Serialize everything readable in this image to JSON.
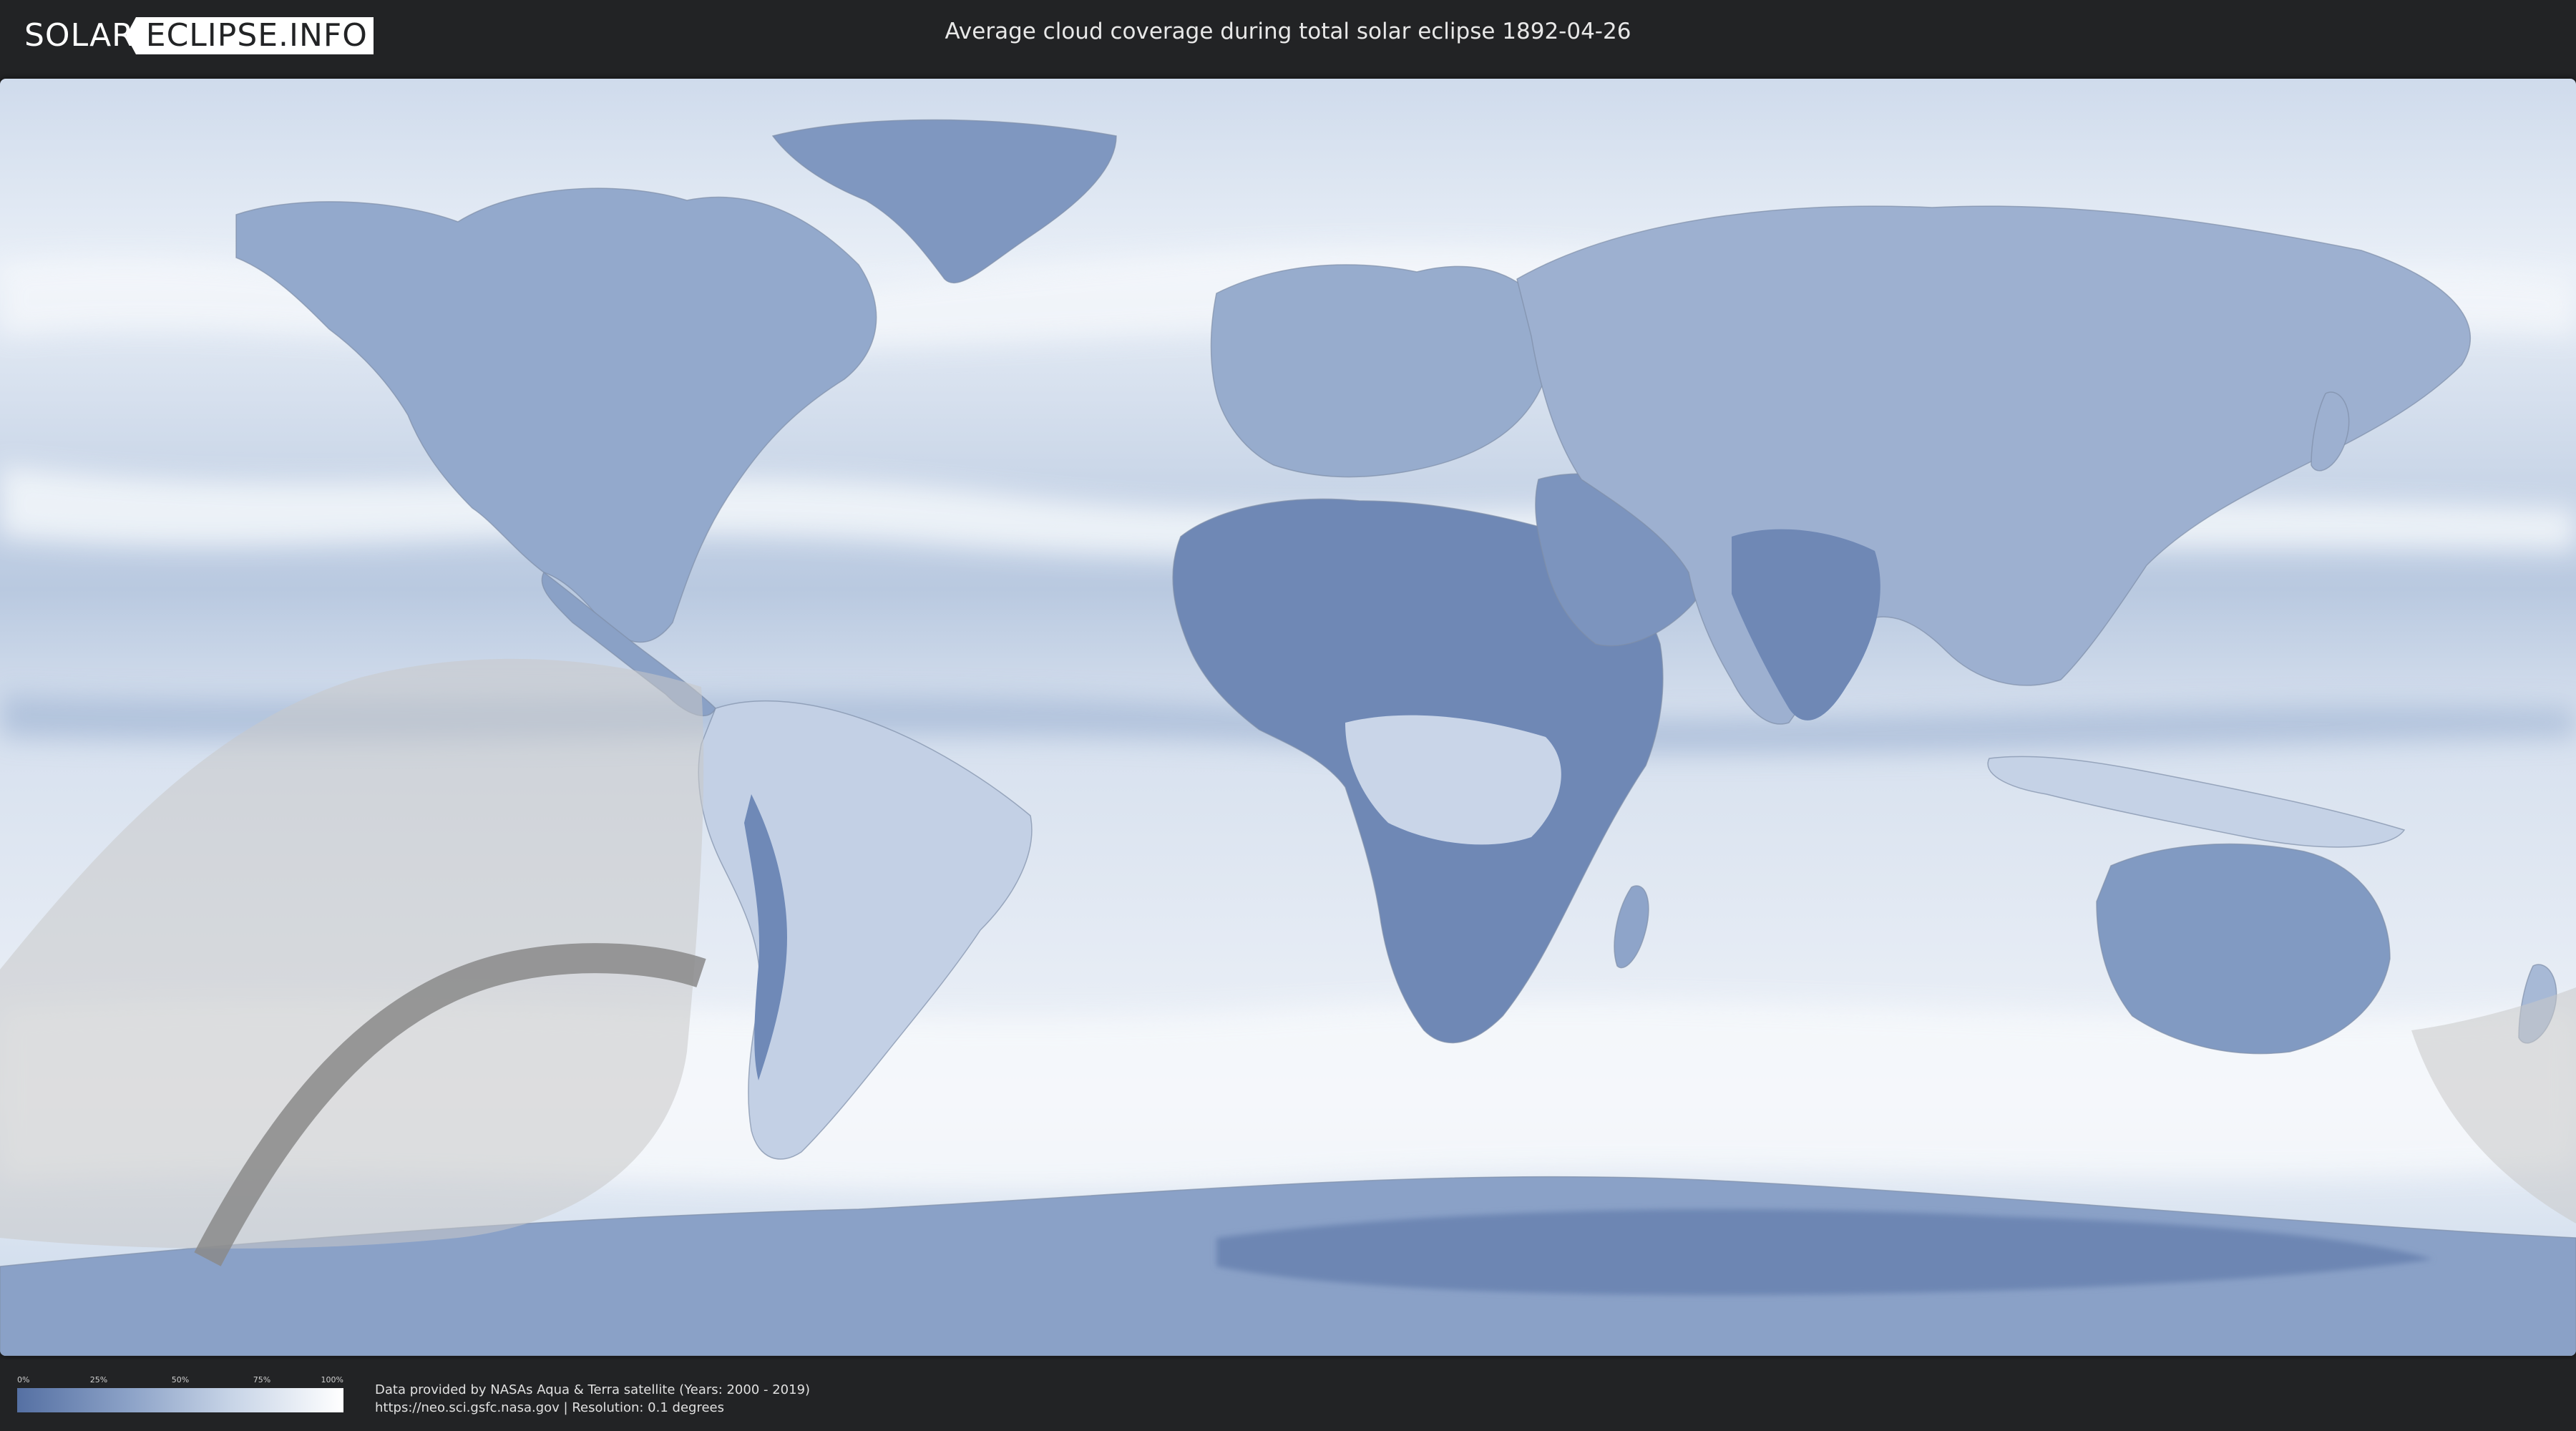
{
  "header": {
    "logo_left": "SOLAR",
    "logo_right": "ECLIPSE.INFO",
    "title": "Average cloud coverage during total solar eclipse 1892-04-26"
  },
  "legend": {
    "ticks": [
      "0%",
      "25%",
      "50%",
      "75%",
      "100%"
    ],
    "gradient_colors": [
      "#5570a3",
      "#8da3c8",
      "#c6d3e6",
      "#ffffff"
    ]
  },
  "credits": {
    "line1": "Data provided by NASAs Aqua & Terra satellite (Years: 2000 - 2019)",
    "line2": "https://neo.sci.gsfc.nasa.gov | Resolution: 0.1 degrees"
  },
  "colors": {
    "land_clear": "#6d86b3",
    "ocean_cloud": "#dde6f2",
    "eclipse_zone": "#c8c8c8",
    "totality_path": "#8a8a8a"
  }
}
